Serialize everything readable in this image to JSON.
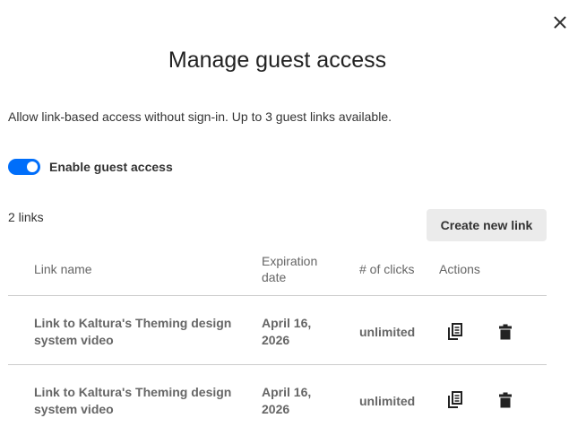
{
  "dialog": {
    "close_label": "Close",
    "title": "Manage guest access",
    "subtitle": "Allow link-based access without sign-in. Up to 3 guest links available.",
    "toggle": {
      "label": "Enable guest access",
      "enabled": true
    },
    "links_count": "2 links",
    "create_button": "Create new link",
    "accent_color": "#006EFA"
  },
  "table": {
    "headers": {
      "name": "Link name",
      "expiration": "Expiration date",
      "clicks": "# of clicks",
      "actions": "Actions"
    },
    "rows": [
      {
        "name": "Link to Kaltura's Theming design system video",
        "expiration": "April 16, 2026",
        "clicks": "unlimited",
        "actions": [
          "copy-icon",
          "trash-icon"
        ]
      },
      {
        "name": "Link to Kaltura's Theming design system video",
        "expiration": "April 16, 2026",
        "clicks": "unlimited",
        "actions": [
          "copy-icon",
          "trash-icon"
        ]
      }
    ]
  }
}
